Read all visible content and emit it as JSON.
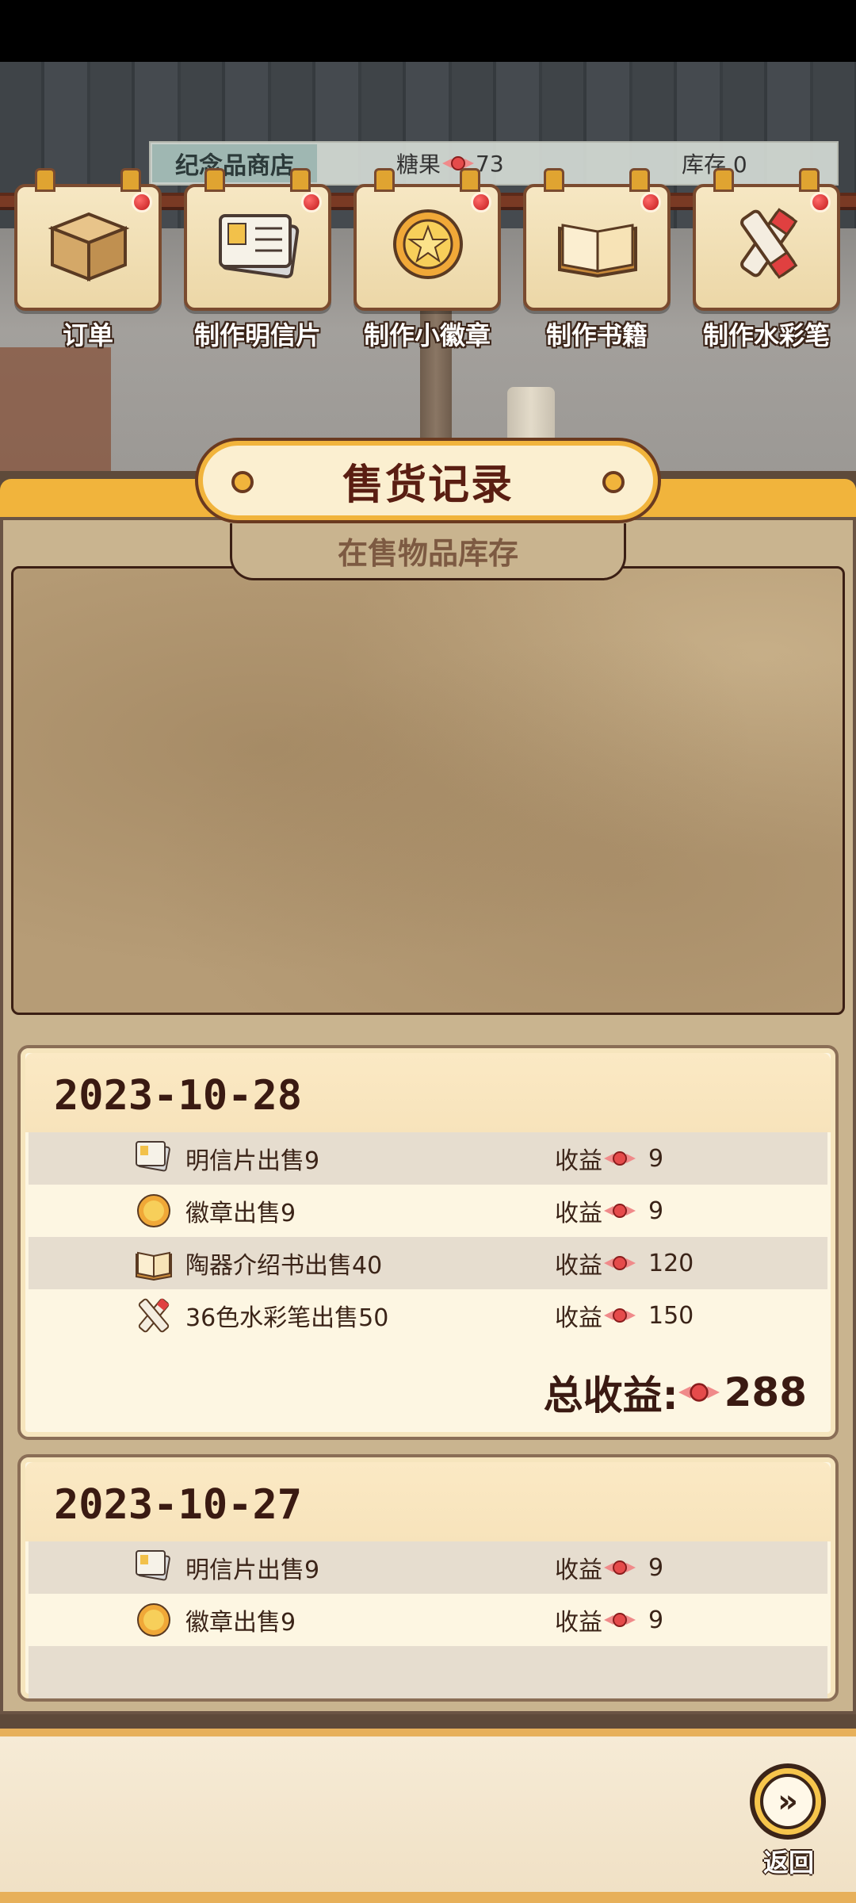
{
  "topbar": {
    "shop_name": "纪念品商店",
    "candy_label": "糖果",
    "candy_value": "73",
    "stock_label": "库存 0"
  },
  "actions": [
    {
      "label": "订单",
      "icon": "box-icon"
    },
    {
      "label": "制作明信片",
      "icon": "postcard-icon"
    },
    {
      "label": "制作小徽章",
      "icon": "badge-icon"
    },
    {
      "label": "制作书籍",
      "icon": "book-icon"
    },
    {
      "label": "制作水彩笔",
      "icon": "marker-icon"
    }
  ],
  "panel": {
    "title": "售货记录",
    "inventory_title": "在售物品库存"
  },
  "income_label": "收益",
  "records": [
    {
      "date": "2023-10-28",
      "rows": [
        {
          "name": "明信片出售9",
          "income": "9",
          "icon": "postcard-icon"
        },
        {
          "name": "徽章出售9",
          "income": "9",
          "icon": "badge-icon"
        },
        {
          "name": "陶器介绍书出售40",
          "income": "120",
          "icon": "book-icon"
        },
        {
          "name": "36色水彩笔出售50",
          "income": "150",
          "icon": "marker-icon"
        }
      ],
      "total_label": "总收益:",
      "total_value": "288"
    },
    {
      "date": "2023-10-27",
      "rows": [
        {
          "name": "明信片出售9",
          "income": "9",
          "icon": "postcard-icon"
        },
        {
          "name": "徽章出售9",
          "income": "9",
          "icon": "badge-icon"
        }
      ]
    }
  ],
  "return_button": {
    "label": "返回",
    "icon": "arrow-right-icon"
  },
  "colors": {
    "accent": "#f1b43c",
    "panel_bg": "#c9b48f",
    "record_bg": "#fdf6e2",
    "candy": "#e54b4b"
  }
}
